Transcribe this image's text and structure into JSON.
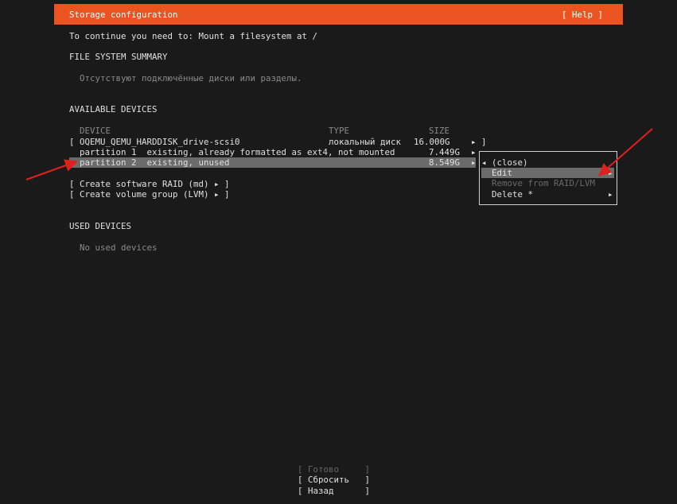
{
  "header": {
    "title": "Storage configuration",
    "help": "[ Help ]"
  },
  "notice": "To continue you need to: Mount a filesystem at /",
  "fs_summary": {
    "heading": "FILE SYSTEM SUMMARY",
    "empty": "Отсутствуют подключённые диски или разделы."
  },
  "available": {
    "heading": "AVAILABLE DEVICES",
    "columns": {
      "device": "DEVICE",
      "type": "TYPE",
      "size": "SIZE"
    },
    "rows": [
      {
        "device": "[ OQEMU_QEMU_HARDDISK_drive-scsi0",
        "type": "локальный диск",
        "size": "16.000G",
        "action": "▸ ]"
      },
      {
        "device": "  partition 1  existing, already formatted as ext4, not mounted",
        "type": "",
        "size": "7.449G",
        "action": "▸"
      },
      {
        "device": "  partition 2  existing, unused",
        "type": "",
        "size": "8.549G",
        "action": "▸"
      }
    ],
    "actions": [
      "[ Create software RAID (md) ▸ ]",
      "[ Create volume group (LVM) ▸ ]"
    ]
  },
  "context_menu": {
    "close": "◂ (close)",
    "items": [
      {
        "label": "Edit",
        "arrow": "▸",
        "disabled": false
      },
      {
        "label": "Remove from RAID/LVM",
        "arrow": "",
        "disabled": true
      },
      {
        "label": "Delete *",
        "arrow": "▸",
        "disabled": false
      }
    ]
  },
  "used": {
    "heading": "USED DEVICES",
    "empty": "No used devices"
  },
  "buttons": {
    "done": "[ Готово     ]",
    "reset": "[ Сбросить   ]",
    "back": "[ Назад      ]"
  },
  "colors": {
    "accent": "#e95420",
    "arrow": "#e0201a"
  }
}
